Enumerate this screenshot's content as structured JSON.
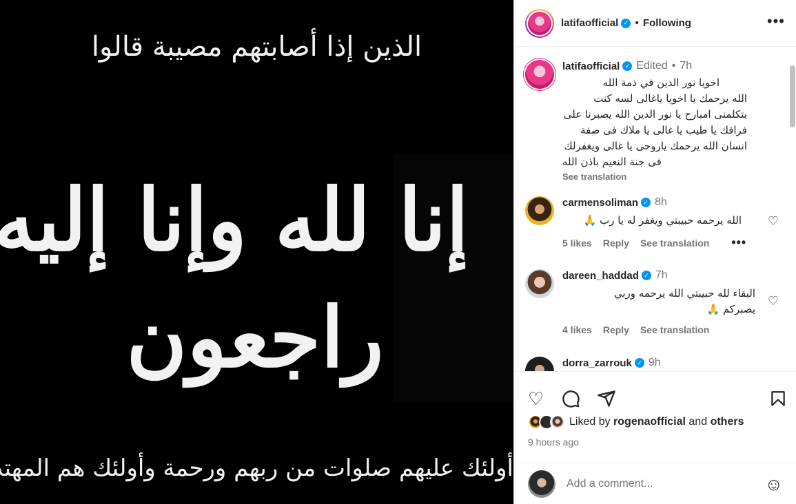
{
  "post_image": {
    "line_top": "الذين إذا أصابتهم مصيبة قالوا",
    "line_main1": "إنا لله وإنا إليه",
    "line_main2": "راجعون",
    "line_bottom": "أولئك عليهم صلوات من ربهم ورحمة وأولئك هم المهتدون"
  },
  "header": {
    "username": "latifaofficial",
    "follow_status": "Following",
    "more_icon": "more-horizontal-icon"
  },
  "caption": {
    "username": "latifaofficial",
    "edited": "Edited",
    "time": "7h",
    "text_lines": [
      "اخويا نور الدين في ذمة الله",
      "الله يرحمك يا اخويا ياغالى لسه كنت",
      "بتكلمنى امبارح يا نور الدين الله يصبرنا على",
      "فراقك يا طيب يا غالى يا ملاك فى صفة",
      "انسان الله يرحمك ياروحى يا غالى ويغفرلك",
      "فى جنة النعيم باذن الله"
    ],
    "see_translation": "See translation"
  },
  "comments": [
    {
      "username": "carmensoliman",
      "time": "8h",
      "text": "الله يرحمه حبيبتي ويغفر له يا رب 🙏",
      "likes": "5 likes",
      "reply": "Reply",
      "see_translation": "See translation"
    },
    {
      "username": "dareen_haddad",
      "time": "7h",
      "text_line1": "البقاء لله حبيبتي الله يرحمه وربي",
      "text_line2": "يصبركم 🙏",
      "likes": "4 likes",
      "reply": "Reply",
      "see_translation": "See translation"
    },
    {
      "username": "dorra_zarrouk",
      "time": "9h"
    }
  ],
  "footer": {
    "liked_prefix": "Liked by",
    "liked_user": "rogenaofficial",
    "liked_and": "and",
    "liked_others": "others",
    "time_ago": "9 hours ago",
    "comment_placeholder": "Add a comment...",
    "icons": [
      "heart-icon",
      "comment-icon",
      "share-icon",
      "bookmark-icon",
      "emoji-icon"
    ]
  }
}
